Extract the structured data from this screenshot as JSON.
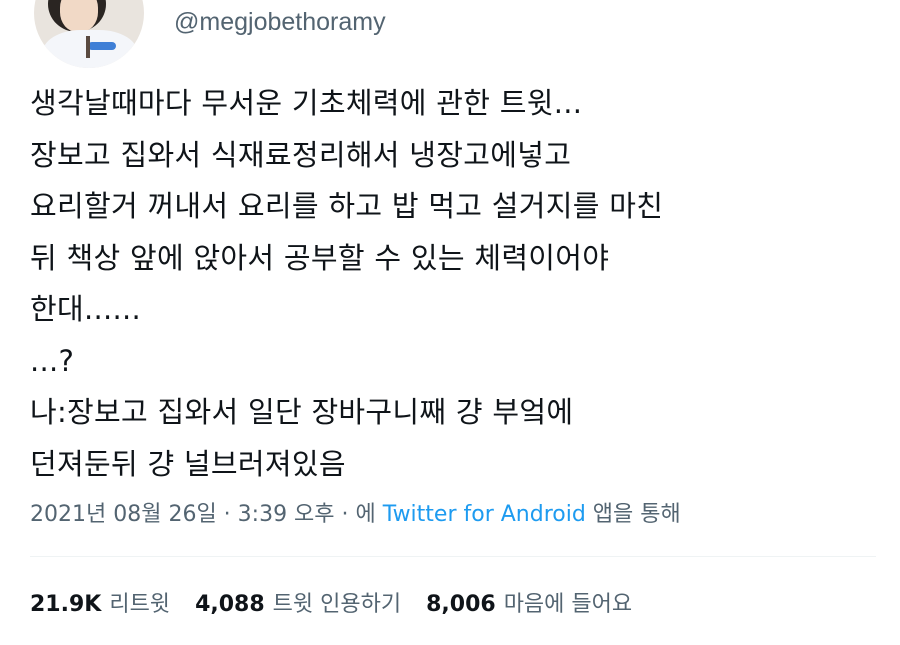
{
  "user": {
    "handle": "@megjobethoramy"
  },
  "tweet": {
    "lines": [
      "생각날때마다 무서운 기초체력에 관한 트윗...",
      "장보고 집와서 식재료정리해서 냉장고에넣고",
      "요리할거 꺼내서 요리를 하고 밥 먹고 설거지를 마친",
      "뒤 책상 앞에 앉아서 공부할 수 있는 체력이어야",
      "한대......",
      "...?",
      "나:장보고 집와서 일단 장바구니째 걍 부엌에",
      "던져둔뒤 걍 널브러져있음"
    ]
  },
  "meta": {
    "datetime": "2021년 08월 26일 · 3:39 오후 · 에 ",
    "source": "Twitter for Android",
    "suffix": " 앱을 통해"
  },
  "stats": {
    "retweets": {
      "count": "21.9K",
      "label": "리트윗"
    },
    "quotes": {
      "count": "4,088",
      "label": "트윗 인용하기"
    },
    "likes": {
      "count": "8,006",
      "label": "마음에 들어요"
    }
  },
  "colors": {
    "text": "#0f1419",
    "secondary": "#536471",
    "link": "#1d9bf0",
    "divider": "#eff3f4"
  }
}
